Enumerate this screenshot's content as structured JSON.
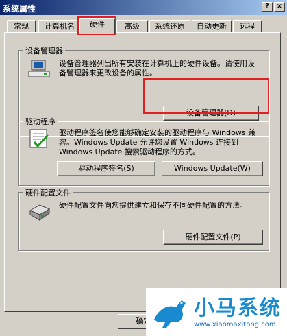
{
  "window": {
    "title": "系统属性",
    "help_glyph": "?",
    "close_glyph": "×"
  },
  "tabs": [
    {
      "label": "常规"
    },
    {
      "label": "计算机名"
    },
    {
      "label": "硬件",
      "active": true
    },
    {
      "label": "高级"
    },
    {
      "label": "系统还原"
    },
    {
      "label": "自动更新"
    },
    {
      "label": "远程"
    }
  ],
  "device_manager": {
    "title": "设备管理器",
    "description": "设备管理器列出所有安装在计算机上的硬件设备。请使用设备管理器来更改设备的属性。",
    "button": "设备管理器(D)",
    "icon": "device-manager-icon"
  },
  "drivers": {
    "title": "驱动程序",
    "description": "驱动程序签名使您能够确定安装的驱动程序与 Windows 兼容。Windows Update 允许您设置 Windows 连接到 Windows Update 搜索驱动程序的方式。",
    "signing_button": "驱动程序签名(S)",
    "update_button": "Windows Update(W)",
    "icon": "driver-signing-icon"
  },
  "hardware_profiles": {
    "title": "硬件配置文件",
    "description": "硬件配置文件向您提供建立和保存不同硬件配置的方法。",
    "button": "硬件配置文件(P)",
    "icon": "hardware-profile-icon"
  },
  "footer": {
    "ok_button": "确定"
  },
  "watermark": {
    "brand": "小马系统",
    "url": "www.xiaomaxitong.com",
    "logo": "horse-logo-icon"
  },
  "colors": {
    "highlight": "#e02020",
    "titlebar": "#0a246a",
    "face": "#d4d0c8"
  }
}
